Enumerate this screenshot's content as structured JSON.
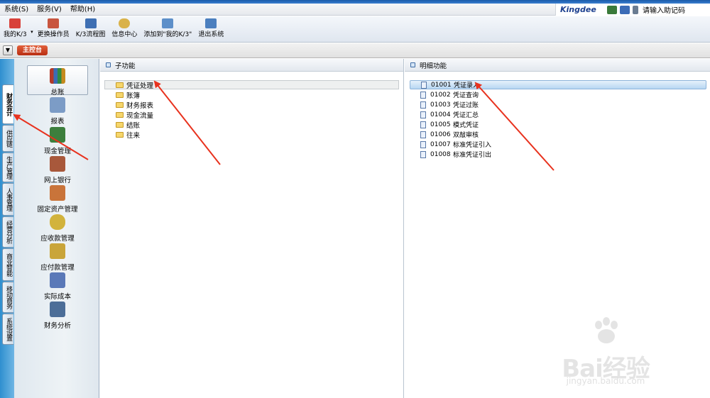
{
  "menubar": {
    "items": [
      {
        "label": "系统(S)"
      },
      {
        "label": "服务(V)"
      },
      {
        "label": "帮助(H)"
      }
    ],
    "brand": "Kingdee",
    "search_placeholder": "请输入助记码"
  },
  "toolbar": {
    "items": [
      {
        "label": "我的K/3",
        "icon": "star-icon"
      },
      {
        "label": "更换操作员",
        "icon": "user-switch-icon"
      },
      {
        "label": "K/3流程图",
        "icon": "flowchart-icon"
      },
      {
        "label": "信息中心",
        "icon": "chat-icon"
      },
      {
        "label": "添加到\"我的K/3\"",
        "icon": "add-favorite-icon"
      },
      {
        "label": "退出系统",
        "icon": "exit-icon"
      }
    ]
  },
  "tabstrip": {
    "main_tab": "主控台"
  },
  "sidetabs": [
    {
      "label": "财务会计",
      "active": true
    },
    {
      "label": "供应链"
    },
    {
      "label": "生产管理"
    },
    {
      "label": "人事管理"
    },
    {
      "label": "经营分析"
    },
    {
      "label": "商业智能"
    },
    {
      "label": "移动商务"
    },
    {
      "label": "系统设置"
    }
  ],
  "modules": [
    {
      "label": "总账",
      "icon": "books-icon",
      "selected": true
    },
    {
      "label": "报表",
      "icon": "report-icon"
    },
    {
      "label": "现金管理",
      "icon": "cash-icon"
    },
    {
      "label": "网上银行",
      "icon": "bank-icon"
    },
    {
      "label": "固定资产管理",
      "icon": "truck-icon"
    },
    {
      "label": "应收款管理",
      "icon": "money-bag-icon"
    },
    {
      "label": "应付款管理",
      "icon": "payment-icon"
    },
    {
      "label": "实际成本",
      "icon": "cost-icon"
    },
    {
      "label": "财务分析",
      "icon": "analysis-icon"
    }
  ],
  "subfunctions": {
    "header": "子功能",
    "items": [
      {
        "label": "凭证处理",
        "selected": true
      },
      {
        "label": "账簿"
      },
      {
        "label": "财务报表"
      },
      {
        "label": "现金流量"
      },
      {
        "label": "结账"
      },
      {
        "label": "往来"
      }
    ]
  },
  "details": {
    "header": "明细功能",
    "items": [
      {
        "code": "01001",
        "label": "凭证录入",
        "selected": true
      },
      {
        "code": "01002",
        "label": "凭证查询"
      },
      {
        "code": "01003",
        "label": "凭证过账"
      },
      {
        "code": "01004",
        "label": "凭证汇总"
      },
      {
        "code": "01005",
        "label": "模式凭证"
      },
      {
        "code": "01006",
        "label": "双敲审核"
      },
      {
        "code": "01007",
        "label": "标准凭证引入"
      },
      {
        "code": "01008",
        "label": "标准凭证引出"
      }
    ]
  },
  "watermark": {
    "brand": "Bai经验",
    "url": "jingyan.baidu.com"
  },
  "colors": {
    "annotation_arrow": "#e8321e",
    "accent_tab": "#c8401c",
    "selection_blue": "#b7d6f2"
  }
}
